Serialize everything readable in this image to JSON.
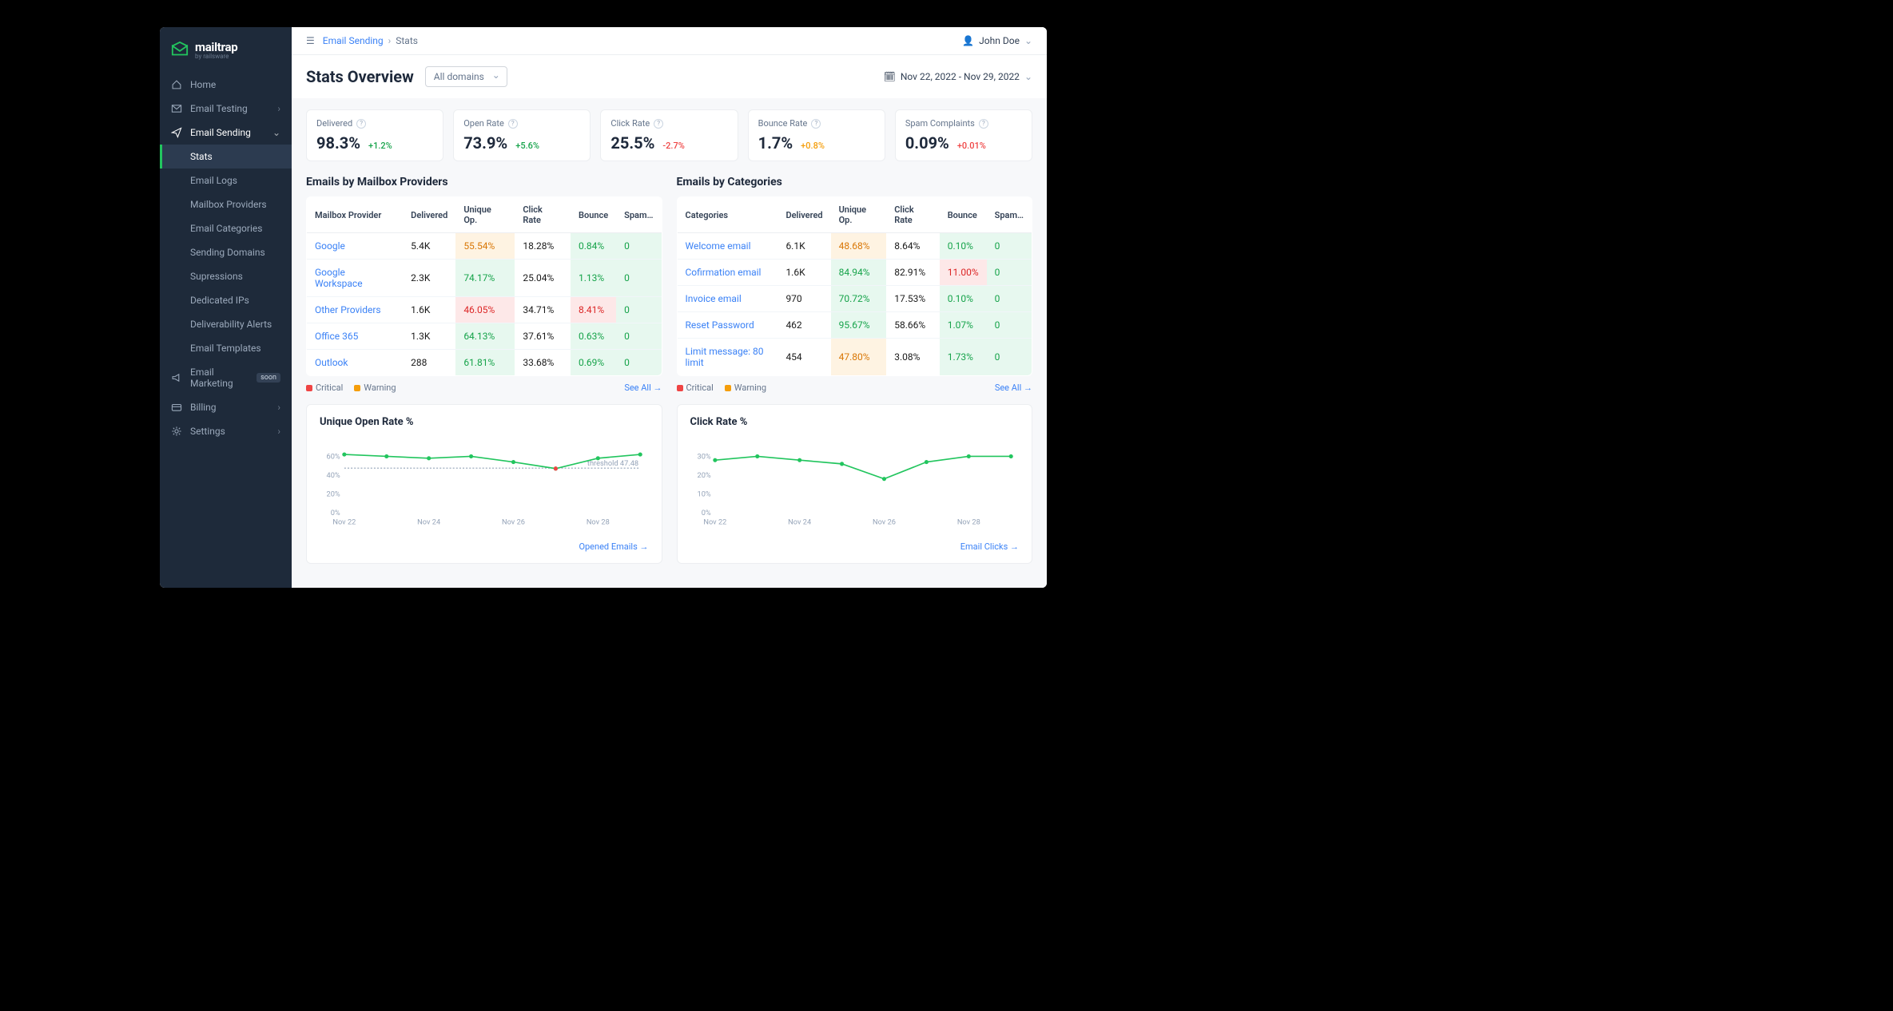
{
  "brand": {
    "name": "mailtrap",
    "sub": "by railsware"
  },
  "sidebar": {
    "items": [
      {
        "label": "Home",
        "icon": "home"
      },
      {
        "label": "Email Testing",
        "icon": "mail",
        "chev": "›"
      },
      {
        "label": "Email Sending",
        "icon": "send",
        "expanded": true,
        "chev": "⌄",
        "children": [
          {
            "label": "Stats",
            "active": true
          },
          {
            "label": "Email Logs"
          },
          {
            "label": "Mailbox Providers"
          },
          {
            "label": "Email Categories"
          },
          {
            "label": "Sending Domains"
          },
          {
            "label": "Supressions"
          },
          {
            "label": "Dedicated IPs"
          },
          {
            "label": "Deliverability Alerts"
          },
          {
            "label": "Email Templates"
          }
        ]
      },
      {
        "label": "Email Marketing",
        "icon": "megaphone",
        "badge": "soon"
      },
      {
        "label": "Billing",
        "icon": "card",
        "chev": "›"
      },
      {
        "label": "Settings",
        "icon": "gear",
        "chev": "›"
      }
    ]
  },
  "breadcrumb": {
    "parent": "Email Sending",
    "current": "Stats"
  },
  "user": {
    "name": "John Doe"
  },
  "page": {
    "title": "Stats Overview",
    "domain_select": "All domains",
    "daterange": "Nov 22, 2022 - Nov 29, 2022"
  },
  "kpis": [
    {
      "label": "Delivered",
      "value": "98.3%",
      "delta": "+1.2%",
      "delta_class": "green"
    },
    {
      "label": "Open Rate",
      "value": "73.9%",
      "delta": "+5.6%",
      "delta_class": "green"
    },
    {
      "label": "Click Rate",
      "value": "25.5%",
      "delta": "-2.7%",
      "delta_class": "red"
    },
    {
      "label": "Bounce Rate",
      "value": "1.7%",
      "delta": "+0.8%",
      "delta_class": "orange"
    },
    {
      "label": "Spam Complaints",
      "value": "0.09%",
      "delta": "+0.01%",
      "delta_class": "red"
    }
  ],
  "table_headers": [
    "Delivered",
    "Unique Op.",
    "Click Rate",
    "Bounce",
    "Spam…"
  ],
  "providers": {
    "heading": "Emails by Mailbox Providers",
    "first_col": "Mailbox Provider",
    "rows": [
      {
        "name": "Google",
        "delivered": "5.4K",
        "uo": "55.54%",
        "uo_class": "cell-orange",
        "cr": "18.28%",
        "b": "0.84%",
        "b_class": "cell-green",
        "sp": "0",
        "sp_class": "cell-green"
      },
      {
        "name": "Google Workspace",
        "delivered": "2.3K",
        "uo": "74.17%",
        "uo_class": "cell-green",
        "cr": "25.04%",
        "b": "1.13%",
        "b_class": "cell-green",
        "sp": "0",
        "sp_class": "cell-green"
      },
      {
        "name": "Other Providers",
        "delivered": "1.6K",
        "uo": "46.05%",
        "uo_class": "cell-red",
        "cr": "34.71%",
        "b": "8.41%",
        "b_class": "cell-red",
        "sp": "0",
        "sp_class": "cell-green"
      },
      {
        "name": "Office 365",
        "delivered": "1.3K",
        "uo": "64.13%",
        "uo_class": "cell-green",
        "cr": "37.61%",
        "b": "0.63%",
        "b_class": "cell-green",
        "sp": "0",
        "sp_class": "cell-green"
      },
      {
        "name": "Outlook",
        "delivered": "288",
        "uo": "61.81%",
        "uo_class": "cell-green",
        "cr": "33.68%",
        "b": "0.69%",
        "b_class": "cell-green",
        "sp": "0",
        "sp_class": "cell-green"
      }
    ],
    "see_all": "See All →"
  },
  "categories": {
    "heading": "Emails by Categories",
    "first_col": "Categories",
    "rows": [
      {
        "name": "Welcome email",
        "delivered": "6.1K",
        "uo": "48.68%",
        "uo_class": "cell-orange",
        "cr": "8.64%",
        "b": "0.10%",
        "b_class": "cell-green",
        "sp": "0",
        "sp_class": "cell-green"
      },
      {
        "name": "Cofirmation email",
        "delivered": "1.6K",
        "uo": "84.94%",
        "uo_class": "cell-green",
        "cr": "82.91%",
        "b": "11.00%",
        "b_class": "cell-red",
        "sp": "0",
        "sp_class": "cell-green"
      },
      {
        "name": "Invoice email",
        "name_class": "orange",
        "delivered": "970",
        "uo": "70.72%",
        "uo_class": "cell-green",
        "cr": "17.53%",
        "b": "0.10%",
        "b_class": "cell-green",
        "sp": "0",
        "sp_class": "cell-green"
      },
      {
        "name": "Reset Password",
        "delivered": "462",
        "uo": "95.67%",
        "uo_class": "cell-green",
        "cr": "58.66%",
        "b": "1.07%",
        "b_class": "cell-green",
        "sp": "0",
        "sp_class": "cell-green"
      },
      {
        "name": "Limit message: 80 limit",
        "delivered": "454",
        "uo": "47.80%",
        "uo_class": "cell-orange",
        "cr": "3.08%",
        "b": "1.73%",
        "b_class": "cell-green",
        "sp": "0",
        "sp_class": "cell-green"
      }
    ],
    "see_all": "See All →"
  },
  "legend": {
    "critical": "Critical",
    "warning": "Warning"
  },
  "chart_data": [
    {
      "type": "line",
      "title": "Unique Open Rate %",
      "x": [
        "Nov 22",
        "Nov 23",
        "Nov 24",
        "Nov 25",
        "Nov 26",
        "Nov 27",
        "Nov 28",
        "Nov 29"
      ],
      "x_ticks": [
        "Nov 22",
        "Nov 24",
        "Nov 26",
        "Nov 28"
      ],
      "values": [
        62,
        60,
        58,
        60,
        54,
        47,
        58,
        62
      ],
      "ylim": [
        0,
        70
      ],
      "y_ticks": [
        0,
        20,
        40,
        60
      ],
      "threshold": 47.48,
      "threshold_label": "threshold 47.48",
      "footer_link": "Opened Emails →"
    },
    {
      "type": "line",
      "title": "Click Rate %",
      "x": [
        "Nov 22",
        "Nov 23",
        "Nov 24",
        "Nov 25",
        "Nov 26",
        "Nov 27",
        "Nov 28",
        "Nov 29"
      ],
      "x_ticks": [
        "Nov 22",
        "Nov 24",
        "Nov 26",
        "Nov 28"
      ],
      "values": [
        28,
        30,
        28,
        26,
        18,
        27,
        30,
        30
      ],
      "ylim": [
        0,
        35
      ],
      "y_ticks": [
        0,
        10,
        20,
        30
      ],
      "footer_link": "Email Clicks →"
    }
  ]
}
